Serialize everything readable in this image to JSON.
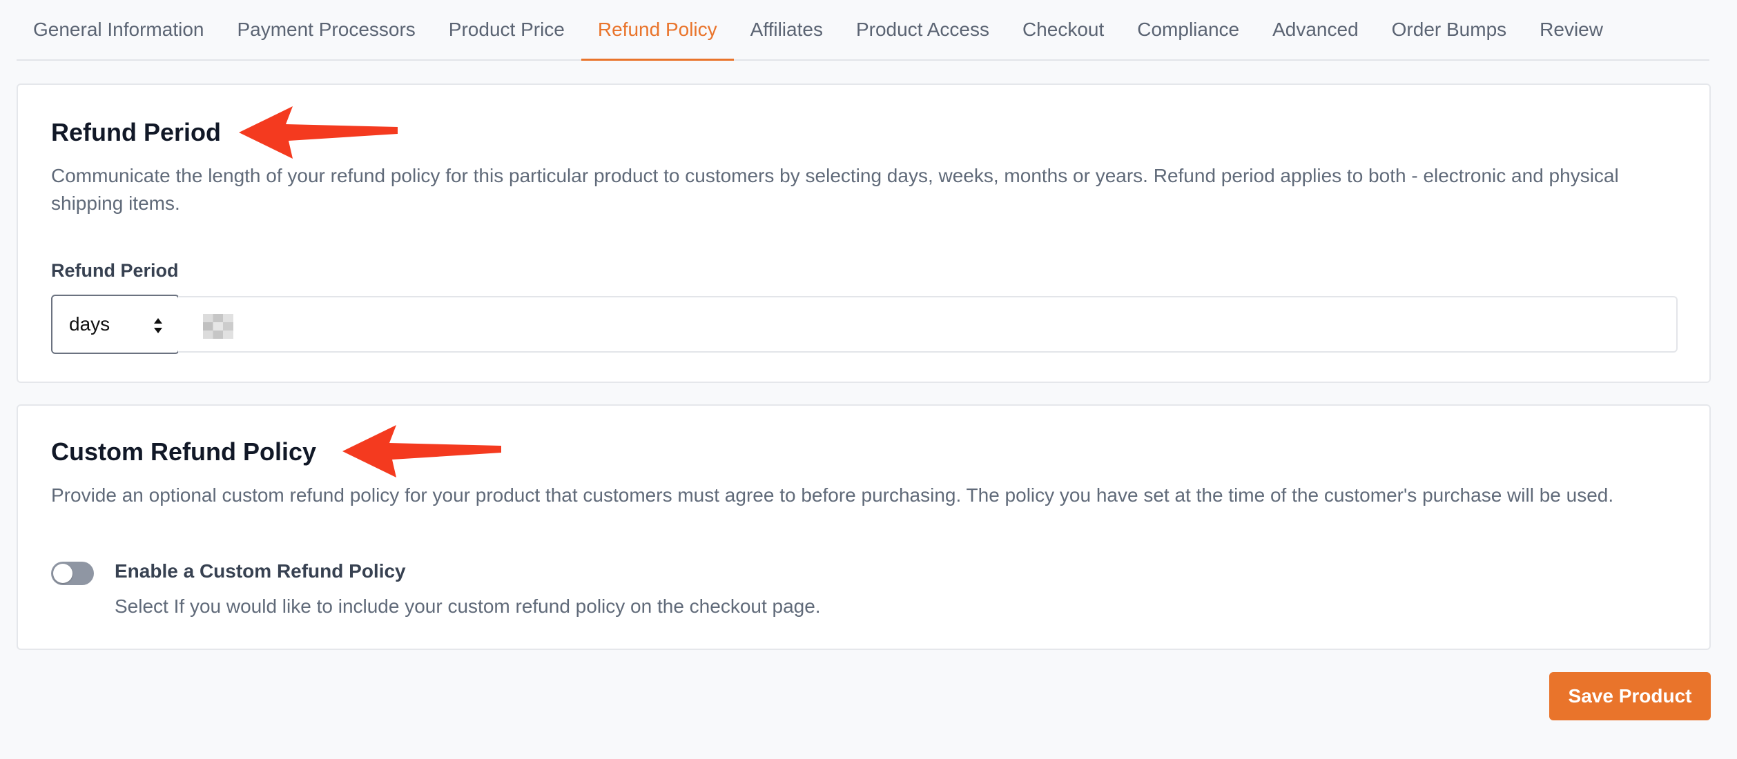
{
  "tabs": [
    {
      "label": "General Information",
      "active": false
    },
    {
      "label": "Payment Processors",
      "active": false
    },
    {
      "label": "Product Price",
      "active": false
    },
    {
      "label": "Refund Policy",
      "active": true
    },
    {
      "label": "Affiliates",
      "active": false
    },
    {
      "label": "Product Access",
      "active": false
    },
    {
      "label": "Checkout",
      "active": false
    },
    {
      "label": "Compliance",
      "active": false
    },
    {
      "label": "Advanced",
      "active": false
    },
    {
      "label": "Order Bumps",
      "active": false
    },
    {
      "label": "Review",
      "active": false
    }
  ],
  "refund_period": {
    "title": "Refund Period",
    "description": "Communicate the length of your refund policy for this particular product to customers by selecting days, weeks, months or years. Refund period applies to both - electronic and physical shipping items.",
    "field_label": "Refund Period",
    "unit_selected": "days",
    "value": ""
  },
  "custom_policy": {
    "title": "Custom Refund Policy",
    "description": "Provide an optional custom refund policy for your product that customers must agree to before purchasing. The policy you have set at the time of the customer's purchase will be used.",
    "toggle_label": "Enable a Custom Refund Policy",
    "toggle_help": "Select If you would like to include your custom refund policy on the checkout page.",
    "toggle_enabled": false
  },
  "actions": {
    "save_label": "Save Product"
  },
  "colors": {
    "accent": "#e9742b",
    "annotation_arrow": "#f43a1f"
  },
  "annotations": [
    {
      "type": "arrow-icon",
      "target": "refund-period-title"
    },
    {
      "type": "arrow-icon",
      "target": "custom-refund-policy-title"
    }
  ]
}
